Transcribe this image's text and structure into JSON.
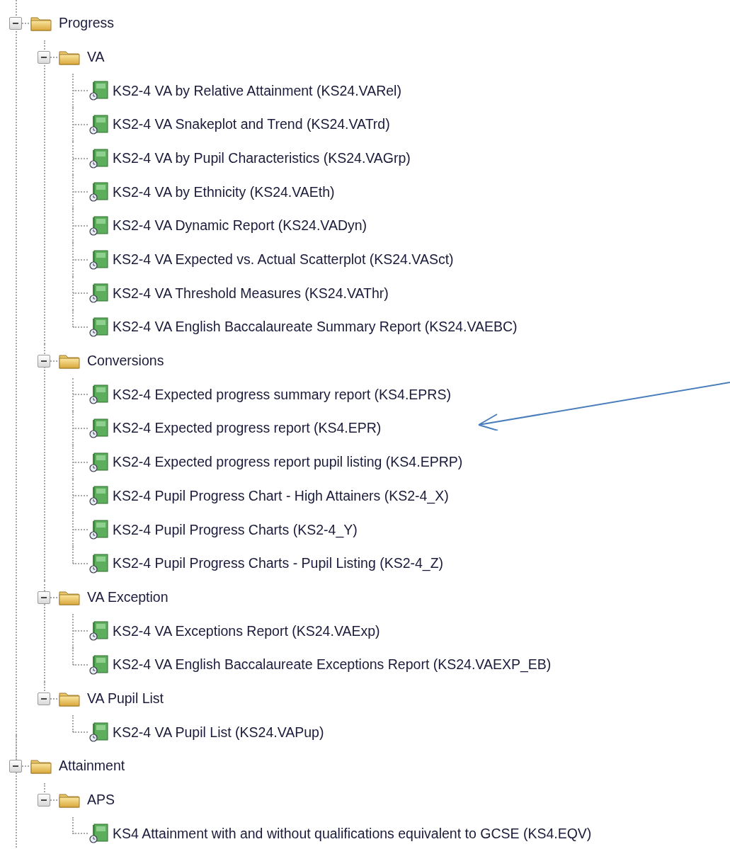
{
  "tree": [
    {
      "kind": "folder",
      "label": "Progress",
      "expanded": true,
      "children": [
        {
          "kind": "folder",
          "label": "VA",
          "expanded": true,
          "children": [
            {
              "kind": "report",
              "label": "KS2-4 VA by Relative Attainment (KS24.VARel)"
            },
            {
              "kind": "report",
              "label": "KS2-4 VA Snakeplot and Trend (KS24.VATrd)"
            },
            {
              "kind": "report",
              "label": "KS2-4 VA by Pupil Characteristics (KS24.VAGrp)"
            },
            {
              "kind": "report",
              "label": "KS2-4 VA by Ethnicity (KS24.VAEth)"
            },
            {
              "kind": "report",
              "label": "KS2-4 VA Dynamic Report (KS24.VADyn)"
            },
            {
              "kind": "report",
              "label": "KS2-4 VA Expected vs. Actual Scatterplot (KS24.VASct)"
            },
            {
              "kind": "report",
              "label": "KS2-4 VA Threshold Measures (KS24.VAThr)"
            },
            {
              "kind": "report",
              "label": "KS2-4 VA English Baccalaureate Summary Report (KS24.VAEBC)"
            }
          ]
        },
        {
          "kind": "folder",
          "label": "Conversions",
          "expanded": true,
          "children": [
            {
              "kind": "report",
              "label": "KS2-4 Expected progress summary report (KS4.EPRS)"
            },
            {
              "kind": "report",
              "label": "KS2-4 Expected progress report (KS4.EPR)"
            },
            {
              "kind": "report",
              "label": "KS2-4 Expected progress report pupil listing (KS4.EPRP)"
            },
            {
              "kind": "report",
              "label": "KS2-4 Pupil Progress Chart - High Attainers (KS2-4_X)"
            },
            {
              "kind": "report",
              "label": "KS2-4 Pupil Progress Charts (KS2-4_Y)"
            },
            {
              "kind": "report",
              "label": "KS2-4 Pupil Progress Charts - Pupil Listing (KS2-4_Z)"
            }
          ]
        },
        {
          "kind": "folder",
          "label": "VA Exception",
          "expanded": true,
          "children": [
            {
              "kind": "report",
              "label": "KS2-4 VA Exceptions Report (KS24.VAExp)"
            },
            {
              "kind": "report",
              "label": "KS2-4 VA English Baccalaureate Exceptions Report (KS24.VAEXP_EB)"
            }
          ]
        },
        {
          "kind": "folder",
          "label": "VA Pupil List",
          "expanded": true,
          "children": [
            {
              "kind": "report",
              "label": "KS2-4 VA Pupil List (KS24.VAPup)"
            }
          ]
        }
      ]
    },
    {
      "kind": "folder",
      "label": "Attainment",
      "expanded": true,
      "children": [
        {
          "kind": "folder",
          "label": "APS",
          "expanded": true,
          "children": [
            {
              "kind": "report",
              "label": "KS4 Attainment with and without qualifications equivalent to GCSE (KS4.EQV)"
            }
          ]
        }
      ]
    }
  ]
}
